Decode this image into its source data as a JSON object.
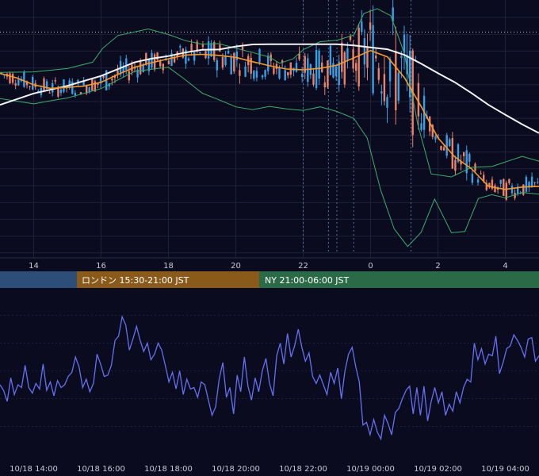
{
  "colors": {
    "background": "#0b0b1f",
    "grid": "#1e2138",
    "candle_up": "#3aa0e6",
    "candle_down": "#e8826a",
    "bollinger": "#3cae6a",
    "ma_short": "#f29a2e",
    "ma_long": "#f2f2f2",
    "session_tokyo": "#2c4e78",
    "session_london": "#8a5a1a",
    "session_ny": "#2a6a46",
    "oscillator": "#6670f0",
    "dotted_price": "#cfcfcf",
    "event_line": "#5a6f9a"
  },
  "top_axis": {
    "ticks": [
      "14",
      "16",
      "18",
      "20",
      "22",
      "0",
      "2",
      "4"
    ]
  },
  "sessions": [
    {
      "label": ""
    },
    {
      "label": "ロンドン 15:30-21:00 JST"
    },
    {
      "label": "NY 21:00-06:00 JST"
    }
  ],
  "bottom_axis": {
    "ticks": [
      "10/18 14:00",
      "10/18 16:00",
      "10/18 18:00",
      "10/18 20:00",
      "10/18 22:00",
      "10/19 00:00",
      "10/19 02:00",
      "10/19 04:00"
    ]
  },
  "chart_data": [
    {
      "type": "candlestick",
      "x_unit": "hours after 10/18 13:00 JST",
      "xlim": [
        0,
        16
      ],
      "x_ticks": [
        1,
        3,
        5,
        7,
        9,
        11,
        13,
        15
      ],
      "ylim": [
        0,
        100
      ],
      "price_line": 87.4,
      "event_lines": [
        9.0,
        9.75,
        10.0,
        10.5,
        12.2
      ],
      "bollinger_upper": [
        [
          0,
          71.5
        ],
        [
          1,
          71.7
        ],
        [
          2,
          73
        ],
        [
          2.75,
          75.5
        ],
        [
          3.05,
          81
        ],
        [
          3.5,
          86
        ],
        [
          4.4,
          88.6
        ],
        [
          5,
          86.4
        ],
        [
          5.5,
          84
        ],
        [
          6,
          82.6
        ],
        [
          6.5,
          82.8
        ],
        [
          7,
          81
        ],
        [
          7.5,
          79.3
        ],
        [
          8,
          77.5
        ],
        [
          8.3,
          75.1
        ],
        [
          8.7,
          76.8
        ],
        [
          9,
          80.4
        ],
        [
          9.5,
          83.6
        ],
        [
          10,
          84.1
        ],
        [
          10.5,
          86.2
        ],
        [
          10.8,
          94.7
        ],
        [
          11.2,
          96.6
        ],
        [
          11.6,
          93.8
        ],
        [
          12,
          79.1
        ],
        [
          12.4,
          51.1
        ],
        [
          12.8,
          31.5
        ],
        [
          13.4,
          30.3
        ],
        [
          14,
          34.1
        ],
        [
          14.6,
          34.4
        ],
        [
          15,
          36.2
        ],
        [
          15.5,
          38.4
        ],
        [
          16,
          36.5
        ]
      ],
      "bollinger_lower": [
        [
          0,
          61.2
        ],
        [
          1,
          59.1
        ],
        [
          1.5,
          60.3
        ],
        [
          2,
          61.4
        ],
        [
          3,
          65.1
        ],
        [
          4,
          71.9
        ],
        [
          5,
          73.5
        ],
        [
          5.5,
          68.6
        ],
        [
          6,
          63.3
        ],
        [
          6.5,
          60.7
        ],
        [
          7,
          57.9
        ],
        [
          7.5,
          56.8
        ],
        [
          8,
          58.1
        ],
        [
          8.5,
          57.1
        ],
        [
          9,
          56.5
        ],
        [
          9.5,
          57.9
        ],
        [
          10,
          56.1
        ],
        [
          10.5,
          53.4
        ],
        [
          10.9,
          45.6
        ],
        [
          11.3,
          25.1
        ],
        [
          11.7,
          9.9
        ],
        [
          12.1,
          2.9
        ],
        [
          12.5,
          8.5
        ],
        [
          12.9,
          21.6
        ],
        [
          13.4,
          8.3
        ],
        [
          13.8,
          8.8
        ],
        [
          14.2,
          21.8
        ],
        [
          14.6,
          23.3
        ],
        [
          15,
          22.1
        ],
        [
          15.5,
          24.2
        ],
        [
          16,
          23.5
        ]
      ],
      "ma_short": [
        [
          0,
          71.1
        ],
        [
          0.5,
          69.3
        ],
        [
          1,
          66.6
        ],
        [
          1.5,
          65.2
        ],
        [
          2,
          65.6
        ],
        [
          2.5,
          66.1
        ],
        [
          3,
          67.6
        ],
        [
          3.5,
          70.7
        ],
        [
          4,
          73.5
        ],
        [
          4.5,
          75.3
        ],
        [
          5,
          76.8
        ],
        [
          5.5,
          78.3
        ],
        [
          6,
          78.6
        ],
        [
          6.5,
          78.2
        ],
        [
          7,
          77.4
        ],
        [
          7.5,
          75.7
        ],
        [
          8,
          74.1
        ],
        [
          8.5,
          72.8
        ],
        [
          9,
          72.5
        ],
        [
          9.5,
          73.1
        ],
        [
          10,
          74.3
        ],
        [
          10.5,
          77.2
        ],
        [
          11,
          80.1
        ],
        [
          11.5,
          77.6
        ],
        [
          12,
          69.5
        ],
        [
          12.5,
          58.1
        ],
        [
          13,
          45.7
        ],
        [
          13.5,
          38.2
        ],
        [
          14,
          33.5
        ],
        [
          14.5,
          26.6
        ],
        [
          15,
          25.4
        ],
        [
          15.5,
          26.3
        ],
        [
          16,
          26.6
        ]
      ],
      "ma_long": [
        [
          0,
          58.7
        ],
        [
          1,
          63.2
        ],
        [
          2,
          66.2
        ],
        [
          3,
          70.1
        ],
        [
          4,
          75.5
        ],
        [
          4.5,
          76.9
        ],
        [
          5,
          77.9
        ],
        [
          5.5,
          79.3
        ],
        [
          6,
          80.4
        ],
        [
          6.5,
          80.5
        ],
        [
          7,
          81.7
        ],
        [
          7.5,
          82.5
        ],
        [
          8,
          82.6
        ],
        [
          8.5,
          82.6
        ],
        [
          9,
          82.6
        ],
        [
          9.5,
          82.6
        ],
        [
          10,
          82.6
        ],
        [
          10.5,
          82.1
        ],
        [
          11,
          81.3
        ],
        [
          11.5,
          80.6
        ],
        [
          12,
          78.4
        ],
        [
          12.5,
          74.9
        ],
        [
          13,
          71.2
        ],
        [
          13.5,
          67.6
        ],
        [
          14,
          63.3
        ],
        [
          14.5,
          58.7
        ],
        [
          15,
          54.8
        ],
        [
          15.5,
          51
        ],
        [
          16,
          47.6
        ]
      ]
    },
    {
      "type": "line",
      "xlim": [
        0,
        16
      ],
      "ylim": [
        0,
        100
      ],
      "grid_y": [
        90,
        70,
        50,
        30,
        10
      ],
      "values": [
        40,
        36,
        28,
        45,
        33,
        40,
        38,
        54,
        38,
        34,
        41,
        37,
        55,
        36,
        42,
        32,
        43,
        38,
        40,
        46,
        49,
        60,
        53,
        38,
        44,
        35,
        41,
        62,
        55,
        46,
        47,
        54,
        72,
        75,
        89,
        83,
        65,
        73,
        82,
        72,
        64,
        70,
        58,
        62,
        70,
        65,
        54,
        42,
        49,
        37,
        50,
        33,
        44,
        37,
        38,
        31,
        42,
        40,
        29,
        18,
        24,
        44,
        56,
        31,
        38,
        19,
        47,
        35,
        60,
        39,
        29,
        45,
        35,
        50,
        59,
        41,
        32,
        61,
        70,
        55,
        77,
        60,
        68,
        80,
        67,
        57,
        63,
        46,
        41,
        47,
        40,
        33,
        49,
        41,
        52,
        30,
        50,
        62,
        67,
        53,
        42,
        11,
        13,
        4,
        15,
        6,
        1,
        18,
        12,
        4,
        20,
        23,
        30,
        36,
        39,
        19,
        38,
        18,
        39,
        14,
        28,
        38,
        27,
        35,
        18,
        26,
        21,
        35,
        27,
        38,
        44,
        42,
        70,
        58,
        66,
        55,
        62,
        61,
        75,
        48,
        56,
        66,
        68,
        76,
        72,
        67,
        60,
        73,
        74,
        57,
        61
      ]
    }
  ]
}
